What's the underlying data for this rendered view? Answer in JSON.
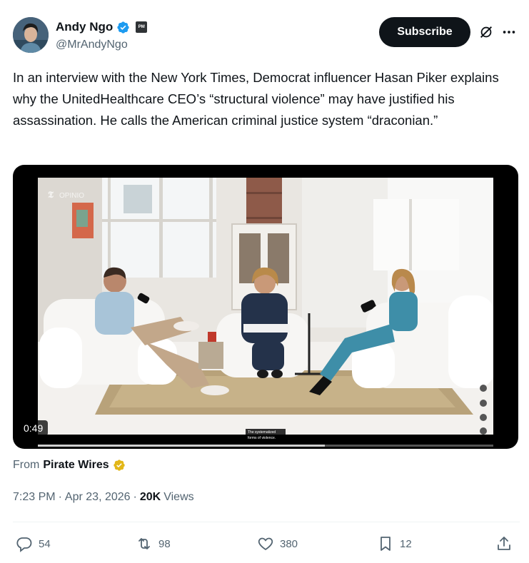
{
  "author": {
    "display_name": "Andy Ngo",
    "handle": "@MrAndyNgo",
    "verified_icon": "verified-badge-icon",
    "affiliate_badge_text": "PM"
  },
  "header": {
    "subscribe_label": "Subscribe"
  },
  "tweet": {
    "text": "In an interview with the New York Times, Democrat influencer Hasan Piker explains why the UnitedHealthcare CEO’s “structural violence” may have justified his assassination. He calls the American criminal justice system “draconian.”"
  },
  "video": {
    "duration": "0:49",
    "watermark": "OPINIO",
    "caption_line1": "The systematized",
    "caption_line2": "forms of violence.",
    "progress": 0.63
  },
  "source": {
    "prefix": "From",
    "name": "Pirate Wires"
  },
  "meta": {
    "time": "7:23 PM",
    "sep1": "·",
    "date": "Apr 23, 2026",
    "sep2": "·",
    "views_count": "20K",
    "views_label": "Views"
  },
  "actions": {
    "replies": "54",
    "reposts": "98",
    "likes": "380",
    "bookmarks": "12"
  },
  "colors": {
    "accent_blue": "#1d9bf0",
    "gold": "#e2b719",
    "text_primary": "#0f1419",
    "text_secondary": "#536471"
  }
}
